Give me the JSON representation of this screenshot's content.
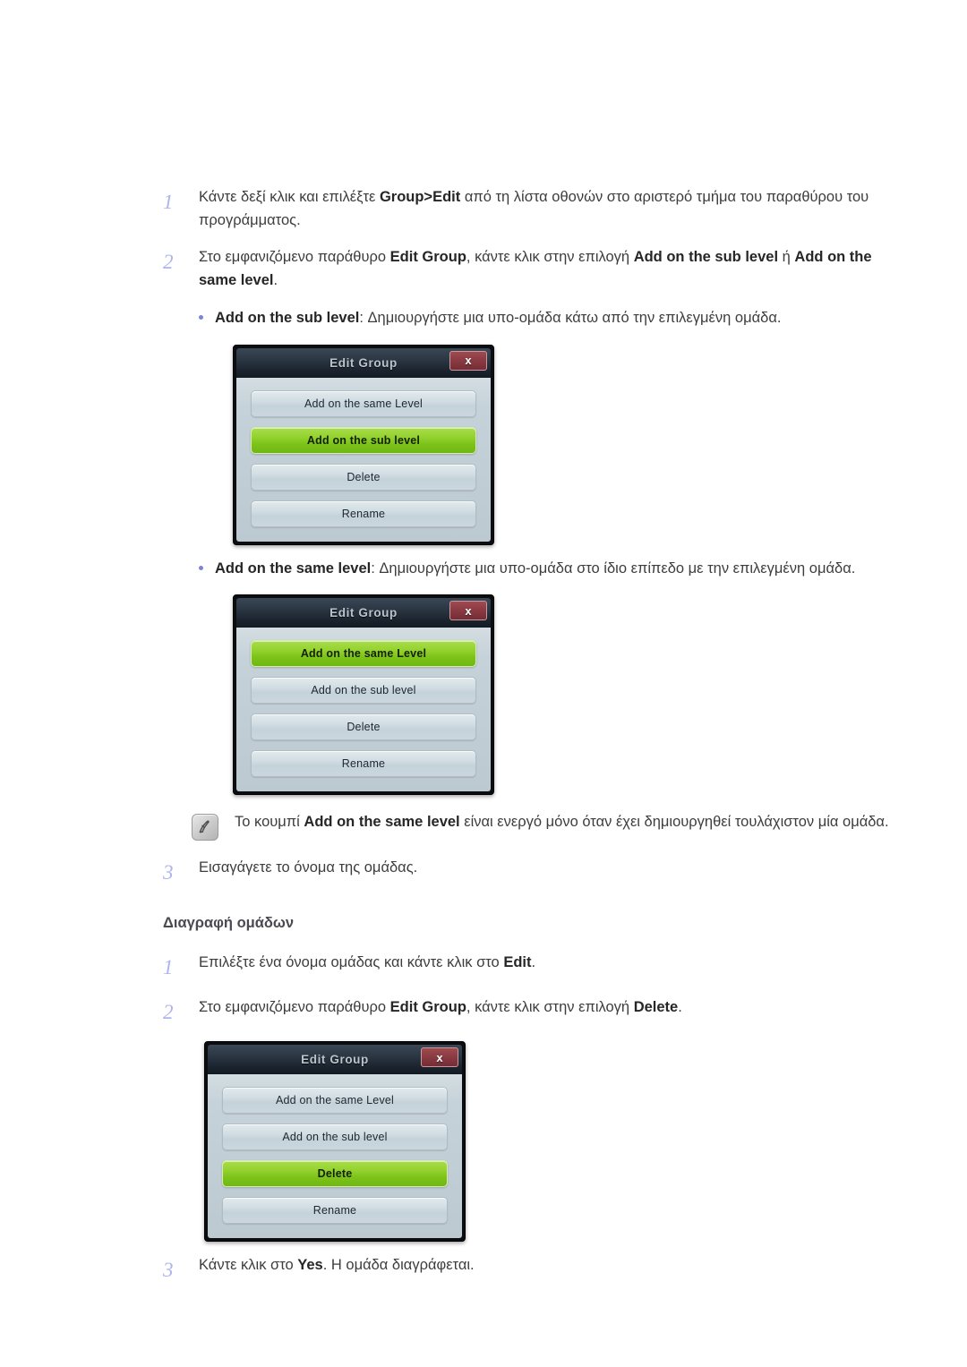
{
  "page": {
    "steps_group_create": [
      {
        "num": "1",
        "parts": [
          {
            "t": "Κάντε δεξί κλικ και επιλέξτε ",
            "b": false
          },
          {
            "t": "Group>Edit",
            "b": true
          },
          {
            "t": " από τη λίστα οθονών στο αριστερό τμήμα του παραθύρου του προγράμματος.",
            "b": false
          }
        ]
      },
      {
        "num": "2",
        "parts": [
          {
            "t": "Στο εμφανιζόμενο παράθυρο ",
            "b": false
          },
          {
            "t": "Edit Group",
            "b": true
          },
          {
            "t": ", κάντε κλικ στην επιλογή ",
            "b": false
          },
          {
            "t": "Add on the sub level",
            "b": true
          },
          {
            "t": " ή ",
            "b": false
          },
          {
            "t": "Add on the same level",
            "b": true
          },
          {
            "t": ".",
            "b": false
          }
        ]
      },
      {
        "num": "3",
        "parts": [
          {
            "t": "Εισαγάγετε το όνομα της ομάδας.",
            "b": false
          }
        ]
      }
    ],
    "bullet_sub_level": [
      {
        "t": "Add on the sub level",
        "b": true
      },
      {
        "t": ": Δημιουργήστε μια υπο-ομάδα κάτω από την επιλεγμένη ομάδα.",
        "b": false
      }
    ],
    "bullet_same_level": [
      {
        "t": "Add on the same level",
        "b": true
      },
      {
        "t": ": Δημιουργήστε μια υπο-ομάδα στο ίδιο επίπεδο με την επιλεγμένη ομάδα.",
        "b": false
      }
    ],
    "note": [
      {
        "t": "Το κουμπί ",
        "b": false
      },
      {
        "t": "Add on the same level",
        "b": true
      },
      {
        "t": " είναι ενεργό μόνο όταν έχει δημιουργηθεί τουλάχιστον μία ομάδα.",
        "b": false
      }
    ],
    "note_icon": "note-pencil-icon",
    "subheading": "Διαγραφή ομάδων",
    "steps_group_delete": [
      {
        "num": "1",
        "parts": [
          {
            "t": "Επιλέξτε ένα όνομα ομάδας και κάντε κλικ στο ",
            "b": false
          },
          {
            "t": "Edit",
            "b": true
          },
          {
            "t": ".",
            "b": false
          }
        ]
      },
      {
        "num": "2",
        "parts": [
          {
            "t": "Στο εμφανιζόμενο παράθυρο ",
            "b": false
          },
          {
            "t": "Edit Group",
            "b": true
          },
          {
            "t": ", κάντε κλικ στην επιλογή ",
            "b": false
          },
          {
            "t": "Delete",
            "b": true
          },
          {
            "t": ".",
            "b": false
          }
        ]
      },
      {
        "num": "3",
        "parts": [
          {
            "t": "Κάντε κλικ στο ",
            "b": false
          },
          {
            "t": "Yes",
            "b": true
          },
          {
            "t": ". Η ομάδα διαγράφεται.",
            "b": false
          }
        ]
      }
    ]
  },
  "dialogs": [
    {
      "id": "edit-group-sub-level",
      "title": "Edit Group",
      "close_label": "x",
      "buttons": [
        {
          "label": "Add on the same Level",
          "selected": false
        },
        {
          "label": "Add on the sub level",
          "selected": true
        },
        {
          "label": "Delete",
          "selected": false
        },
        {
          "label": "Rename",
          "selected": false
        }
      ]
    },
    {
      "id": "edit-group-same-level",
      "title": "Edit Group",
      "close_label": "x",
      "buttons": [
        {
          "label": "Add on the same Level",
          "selected": true
        },
        {
          "label": "Add on the sub level",
          "selected": false
        },
        {
          "label": "Delete",
          "selected": false
        },
        {
          "label": "Rename",
          "selected": false
        }
      ]
    },
    {
      "id": "edit-group-delete",
      "title": "Edit Group",
      "close_label": "x",
      "buttons": [
        {
          "label": "Add on the same Level",
          "selected": false
        },
        {
          "label": "Add on the sub level",
          "selected": false
        },
        {
          "label": "Delete",
          "selected": true
        },
        {
          "label": "Rename",
          "selected": false
        }
      ]
    }
  ],
  "colors": {
    "step_number": "#aeb4ed",
    "bullet_dot": "#7b85d8",
    "selected_button_green": "#8ccd28",
    "close_button_red": "#8c3b43",
    "dialog_titlebar": "#2b3643",
    "dialog_body": "#c6d2d9",
    "text": "#3d3d3d"
  }
}
